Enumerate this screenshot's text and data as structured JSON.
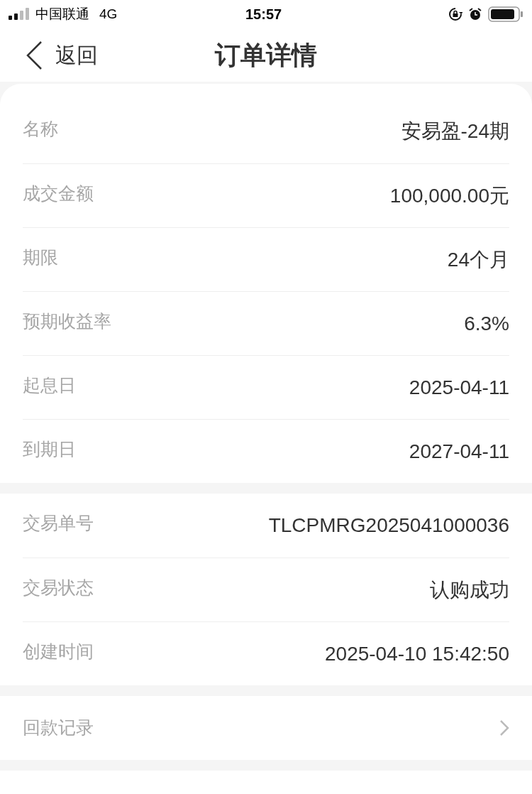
{
  "status_bar": {
    "carrier": "中国联通",
    "network": "4G",
    "time": "15:57"
  },
  "nav": {
    "back_label": "返回",
    "title": "订单详情"
  },
  "sections": [
    {
      "rows": [
        {
          "label": "名称",
          "value": "安易盈-24期"
        },
        {
          "label": "成交金额",
          "value": "100,000.00元"
        },
        {
          "label": "期限",
          "value": "24个月"
        },
        {
          "label": "预期收益率",
          "value": "6.3%"
        },
        {
          "label": "起息日",
          "value": "2025-04-11"
        },
        {
          "label": "到期日",
          "value": "2027-04-11"
        }
      ]
    },
    {
      "rows": [
        {
          "label": "交易单号",
          "value": "TLCPMRG2025041000036"
        },
        {
          "label": "交易状态",
          "value": "认购成功"
        },
        {
          "label": "创建时间",
          "value": "2025-04-10 15:42:50"
        }
      ]
    }
  ],
  "link_row": {
    "label": "回款记录"
  }
}
